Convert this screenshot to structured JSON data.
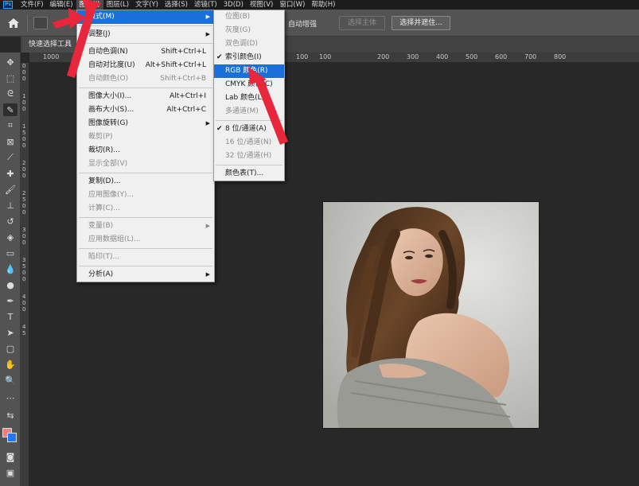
{
  "app_icon": "Ps",
  "menubar": [
    "文件(F)",
    "编辑(E)",
    "图像(I)",
    "图层(L)",
    "文字(Y)",
    "选择(S)",
    "滤镜(T)",
    "3D(D)",
    "视图(V)",
    "窗口(W)",
    "帮助(H)"
  ],
  "options": {
    "auto_enhance": "自动增强",
    "select_subject": "选择主体",
    "select_and_mask": "选择并遮住..."
  },
  "doc_tab": "快速选择工具",
  "ruler_top": [
    "1000",
    "100",
    "100",
    "200",
    "300",
    "400",
    "500",
    "600",
    "700",
    "800"
  ],
  "ruler_left": [
    "0",
    "0",
    "0",
    "1",
    "0",
    "0",
    "1",
    "5",
    "0",
    "0",
    "2",
    "0",
    "0",
    "2",
    "5",
    "0",
    "0",
    "3",
    "0",
    "0",
    "3",
    "5",
    "0",
    "0",
    "4",
    "0",
    "0",
    "4",
    "5"
  ],
  "image_menu": {
    "items": [
      {
        "label": "模式(M)",
        "submenu": true,
        "highlight": true
      },
      {
        "sep": true
      },
      {
        "label": "调整(J)",
        "submenu": true
      },
      {
        "sep": true
      },
      {
        "label": "自动色调(N)",
        "shortcut": "Shift+Ctrl+L"
      },
      {
        "label": "自动对比度(U)",
        "shortcut": "Alt+Shift+Ctrl+L"
      },
      {
        "label": "自动颜色(O)",
        "shortcut": "Shift+Ctrl+B",
        "disabled": true
      },
      {
        "sep": true
      },
      {
        "label": "图像大小(I)...",
        "shortcut": "Alt+Ctrl+I"
      },
      {
        "label": "画布大小(S)...",
        "shortcut": "Alt+Ctrl+C"
      },
      {
        "label": "图像旋转(G)",
        "submenu": true
      },
      {
        "label": "裁剪(P)",
        "disabled": true
      },
      {
        "label": "裁切(R)..."
      },
      {
        "label": "显示全部(V)",
        "disabled": true
      },
      {
        "sep": true
      },
      {
        "label": "复制(D)..."
      },
      {
        "label": "应用图像(Y)...",
        "disabled": true
      },
      {
        "label": "计算(C)...",
        "disabled": true
      },
      {
        "sep": true
      },
      {
        "label": "变量(B)",
        "submenu": true,
        "disabled": true
      },
      {
        "label": "应用数据组(L)...",
        "disabled": true
      },
      {
        "sep": true
      },
      {
        "label": "陷印(T)...",
        "disabled": true
      },
      {
        "sep": true
      },
      {
        "label": "分析(A)",
        "submenu": true
      }
    ]
  },
  "mode_menu": {
    "items": [
      {
        "label": "位图(B)",
        "disabled": true
      },
      {
        "label": "灰度(G)",
        "disabled": true
      },
      {
        "label": "双色调(D)",
        "disabled": true
      },
      {
        "label": "索引颜色(I)",
        "checked": true
      },
      {
        "label": "RGB 颜色(R)",
        "highlight": true
      },
      {
        "label": "CMYK 颜色(C)"
      },
      {
        "label": "Lab 颜色(L)"
      },
      {
        "label": "多通道(M)",
        "disabled": true
      },
      {
        "sep": true
      },
      {
        "label": "8 位/通道(A)",
        "checked": true
      },
      {
        "label": "16 位/通道(N)",
        "disabled": true
      },
      {
        "label": "32 位/通道(H)",
        "disabled": true
      },
      {
        "sep": true
      },
      {
        "label": "颜色表(T)..."
      }
    ]
  },
  "colors": {
    "foreground": "#ee8080",
    "background": "#2277ff",
    "highlight": "#1a6fd8",
    "annotation_arrow": "#e8263c"
  }
}
